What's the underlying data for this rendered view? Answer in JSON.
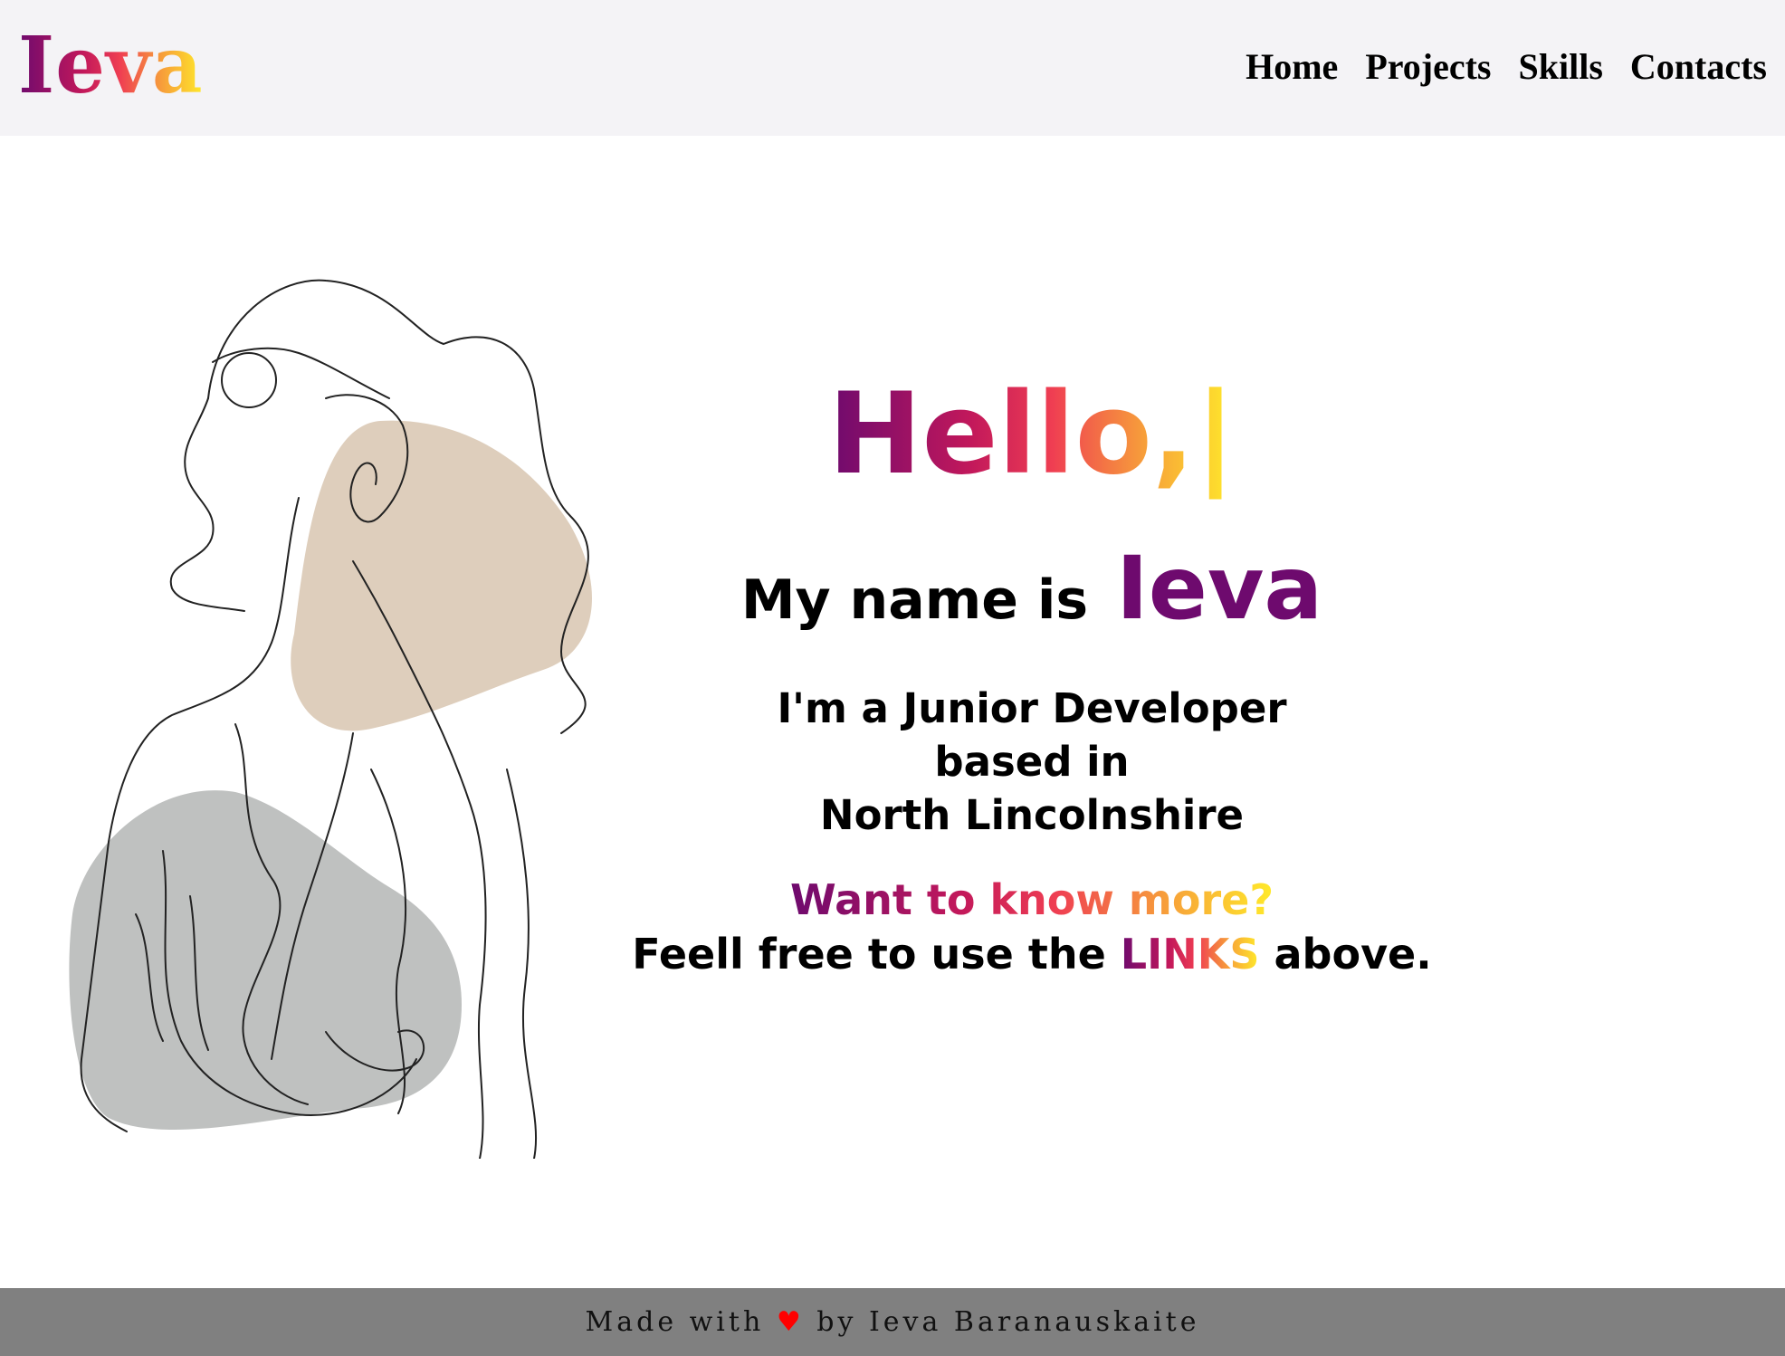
{
  "header": {
    "logo": "Ieva",
    "nav": [
      "Home",
      "Projects",
      "Skills",
      "Contacts"
    ]
  },
  "hero": {
    "greeting": "Hello,",
    "cursor": "|",
    "intro": "My name is",
    "name": "Ieva",
    "role_line1": "I'm a Junior Developer",
    "role_line2": "based in",
    "role_line3": "North Lincolnshire",
    "question": "Want to know more?",
    "cta_before": "Feell free to use the",
    "cta_link": "LINKS",
    "cta_after": "above."
  },
  "footer": {
    "made_with": "Made with",
    "heart": "♥",
    "by": "by Ieva Baranauskaite"
  },
  "colors": {
    "gradient": [
      "#6e0a6e",
      "#c2185b",
      "#ef3e52",
      "#f7a03a",
      "#ffea2a"
    ],
    "header_bg": "#f4f3f6",
    "footer_bg": "#808080",
    "blob_beige": "#dccbb8",
    "blob_gray": "#bfc1c0"
  }
}
